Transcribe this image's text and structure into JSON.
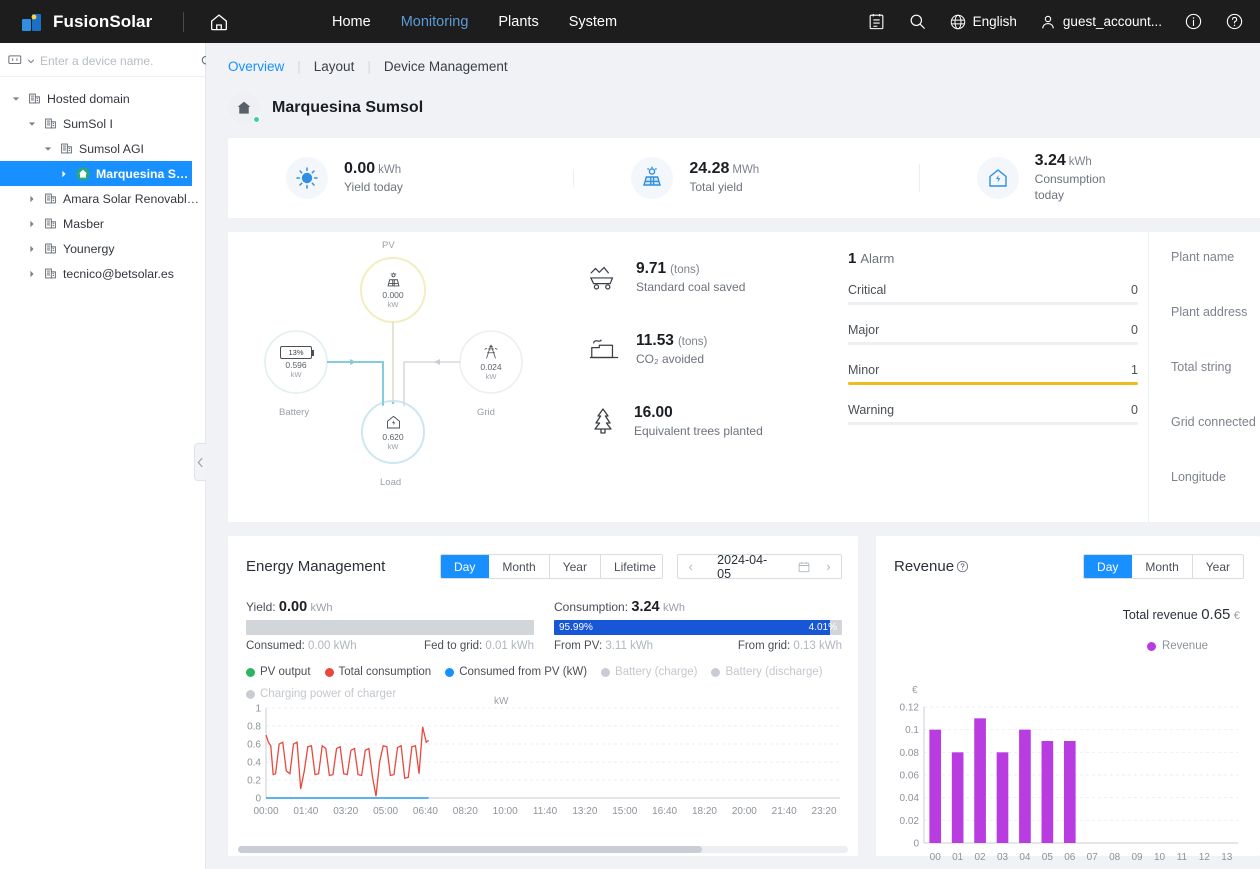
{
  "topnav": {
    "brand": "FusionSolar",
    "home_icon": "home-icon",
    "links": [
      {
        "label": "Home",
        "active": false
      },
      {
        "label": "Monitoring",
        "active": true
      },
      {
        "label": "Plants",
        "active": false
      },
      {
        "label": "System",
        "active": false
      }
    ],
    "right": {
      "report_icon": "report-icon",
      "search_icon": "search-icon",
      "language_icon": "globe-icon",
      "language": "English",
      "user_icon": "user-icon",
      "user": "guest_account...",
      "info_icon": "info-icon",
      "help_icon": "help-icon"
    }
  },
  "sidebar": {
    "device_selector_icon": "device-filter-icon",
    "search_placeholder": "Enter a device name.",
    "search_value": "",
    "search_icon": "search-icon",
    "collapse_icon": "chevron-left-icon",
    "tree": [
      {
        "label": "Hosted domain",
        "depth": 0,
        "expanded": true,
        "icon": "domain-icon",
        "selected": false
      },
      {
        "label": "SumSol I",
        "depth": 1,
        "expanded": true,
        "icon": "domain-icon",
        "selected": false
      },
      {
        "label": "Sumsol AGI",
        "depth": 2,
        "expanded": true,
        "icon": "domain-icon",
        "selected": false
      },
      {
        "label": "Marquesina Sumsol",
        "depth": 3,
        "expanded": false,
        "icon": "plant-icon",
        "selected": true
      },
      {
        "label": "Amara Solar Renovables ...",
        "depth": 1,
        "expanded": false,
        "icon": "domain-icon",
        "selected": false
      },
      {
        "label": "Masber",
        "depth": 1,
        "expanded": false,
        "icon": "domain-icon",
        "selected": false
      },
      {
        "label": "Younergy",
        "depth": 1,
        "expanded": false,
        "icon": "domain-icon",
        "selected": false
      },
      {
        "label": "tecnico@betsolar.es",
        "depth": 1,
        "expanded": false,
        "icon": "domain-icon",
        "selected": false
      }
    ]
  },
  "subnav": {
    "items": [
      {
        "label": "Overview",
        "active": true
      },
      {
        "label": "Layout",
        "active": false
      },
      {
        "label": "Device Management",
        "active": false
      }
    ],
    "separator": "|"
  },
  "plant": {
    "name": "Marquesina Sumsol",
    "status_icon": "plant-home-icon"
  },
  "kpis": [
    {
      "value": "0.00",
      "unit": "kWh",
      "label": "Yield today",
      "icon": "sun-yield-icon"
    },
    {
      "value": "24.28",
      "unit": "MWh",
      "label": "Total yield",
      "icon": "solar-panel-icon"
    },
    {
      "value": "3.24",
      "unit": "kWh",
      "label": "Consumption today",
      "icon": "consumption-icon"
    }
  ],
  "flow": {
    "nodes": [
      {
        "id": "pv",
        "caption": "PV",
        "value": "0.000",
        "unit": "kW",
        "icon": "solar-panel-icon"
      },
      {
        "id": "battery",
        "caption": "Battery",
        "value": "0.596",
        "unit": "kW",
        "icon": "battery-icon",
        "soc": "13%"
      },
      {
        "id": "grid",
        "caption": "Grid",
        "value": "0.024",
        "unit": "kW",
        "icon": "pylon-icon"
      },
      {
        "id": "load",
        "caption": "Load",
        "value": "0.620",
        "unit": "kW",
        "icon": "house-icon"
      }
    ]
  },
  "environment": [
    {
      "value": "9.71",
      "unit": "(tons)",
      "label": "Standard coal saved",
      "icon": "coal-cart-icon"
    },
    {
      "value": "11.53",
      "unit": "(tons)",
      "label": "CO₂ avoided",
      "icon": "factory-icon"
    },
    {
      "value": "16.00",
      "unit": "",
      "label": "Equivalent trees planted",
      "icon": "tree-icon"
    }
  ],
  "alarms": {
    "count": "1",
    "title": "Alarm",
    "rows": [
      {
        "label": "Critical",
        "value": "0",
        "filled": false
      },
      {
        "label": "Major",
        "value": "0",
        "filled": false
      },
      {
        "label": "Minor",
        "value": "1",
        "filled": true
      },
      {
        "label": "Warning",
        "value": "0",
        "filled": false
      }
    ],
    "bar_color": "#f0bb20"
  },
  "plant_info": [
    {
      "label": "Plant name"
    },
    {
      "label": "Plant address"
    },
    {
      "label": "Total string"
    },
    {
      "label": "Grid connected"
    },
    {
      "label": "Longitude"
    }
  ],
  "energy_panel": {
    "title": "Energy Management",
    "range_tabs": [
      {
        "label": "Day",
        "active": true
      },
      {
        "label": "Month",
        "active": false
      },
      {
        "label": "Year",
        "active": false
      },
      {
        "label": "Lifetime",
        "active": false
      }
    ],
    "date": "2024-04-05",
    "prev_icon": "chevron-left-icon",
    "next_icon": "chevron-right-icon",
    "calendar_icon": "calendar-icon",
    "yield": {
      "title_label": "Yield:",
      "value": "0.00",
      "unit": "kWh",
      "left_label": "Consumed:",
      "left_value": "0.00 kWh",
      "right_label": "Fed to grid:",
      "right_value": "0.01 kWh",
      "bar_left_pct": "",
      "bar_right_pct": "",
      "fill_percent": 0
    },
    "consumption": {
      "title_label": "Consumption:",
      "value": "3.24",
      "unit": "kWh",
      "left_label": "From PV:",
      "left_value": "3.11 kWh",
      "right_label": "From grid:",
      "right_value": "0.13 kWh",
      "bar_left_pct": "95.99%",
      "bar_right_pct": "4.01%",
      "fill_percent": 95.99
    },
    "legend": [
      {
        "label": "PV output",
        "color": "#2cb463",
        "active": true
      },
      {
        "label": "Total consumption",
        "color": "#e8483f",
        "active": true
      },
      {
        "label": "Consumed from PV (kW)",
        "color": "#1890ff",
        "active": true
      },
      {
        "label": "Battery (charge)",
        "color": "#c8cdd4",
        "active": false
      },
      {
        "label": "Battery (discharge)",
        "color": "#c8cdd4",
        "active": false
      },
      {
        "label": "Charging power of charger",
        "color": "#c8cdd4",
        "active": false
      }
    ]
  },
  "revenue_panel": {
    "title": "Revenue",
    "help_icon": "question-circle-icon",
    "range_tabs": [
      {
        "label": "Day",
        "active": true
      },
      {
        "label": "Month",
        "active": false
      },
      {
        "label": "Year",
        "active": false
      }
    ],
    "total_label": "Total revenue",
    "total_value": "0.65",
    "currency": "€",
    "legend_label": "Revenue",
    "legend_color": "#b83ce0"
  },
  "chart_data": [
    {
      "type": "line",
      "title": "Energy Management",
      "ylabel": "kW",
      "xlabel": "",
      "ylim": [
        0,
        1
      ],
      "yticks": [
        0,
        0.2,
        0.4,
        0.6,
        0.8,
        1
      ],
      "ytick_labels": [
        "0",
        "0.2",
        "0.4",
        "0.6",
        "0.8",
        "1"
      ],
      "xtick_labels": [
        "00:00",
        "01:40",
        "03:20",
        "05:00",
        "06:40",
        "08:20",
        "10:00",
        "11:40",
        "13:20",
        "15:00",
        "16:40",
        "18:20",
        "20:00",
        "21:40",
        "23:20"
      ],
      "grid": true,
      "legend_position": "top",
      "series": [
        {
          "name": "Total consumption",
          "color": "#e8483f",
          "x": [
            0.0,
            0.1,
            0.2,
            0.3,
            0.4,
            0.55,
            0.7,
            0.85,
            1.0,
            1.15,
            1.3,
            1.45,
            1.6,
            1.75,
            1.9,
            2.05,
            2.2,
            2.35,
            2.5,
            2.65,
            2.8,
            2.95,
            3.1,
            3.25,
            3.4,
            3.55,
            3.7,
            3.85,
            4.0,
            4.15,
            4.3,
            4.45,
            4.6,
            4.75,
            4.9,
            5.05,
            5.2,
            5.35,
            5.5,
            5.65,
            5.8,
            5.95,
            6.1,
            6.25,
            6.4,
            6.55,
            6.7,
            6.8
          ],
          "y": [
            0.7,
            0.62,
            0.58,
            0.26,
            0.27,
            0.6,
            0.62,
            0.3,
            0.27,
            0.6,
            0.62,
            0.1,
            0.3,
            0.57,
            0.58,
            0.26,
            0.27,
            0.58,
            0.55,
            0.25,
            0.26,
            0.55,
            0.57,
            0.27,
            0.26,
            0.53,
            0.55,
            0.26,
            0.25,
            0.53,
            0.55,
            0.24,
            0.02,
            0.4,
            0.58,
            0.57,
            0.25,
            0.26,
            0.56,
            0.58,
            0.22,
            0.23,
            0.57,
            0.58,
            0.27,
            0.79,
            0.62,
            0.64
          ]
        },
        {
          "name": "PV output",
          "color": "#2cb463",
          "x": [
            0,
            6.8
          ],
          "y": [
            0,
            0
          ]
        },
        {
          "name": "Consumed from PV (kW)",
          "color": "#1890ff",
          "x": [
            0,
            6.8
          ],
          "y": [
            0,
            0
          ]
        }
      ]
    },
    {
      "type": "bar",
      "title": "Revenue",
      "ylabel": "€",
      "xlabel": "",
      "ylim": [
        0,
        0.12
      ],
      "yticks": [
        0,
        0.02,
        0.04,
        0.06,
        0.08,
        0.1,
        0.12
      ],
      "ytick_labels": [
        "0",
        "0.02",
        "0.04",
        "0.06",
        "0.08",
        "0.1",
        "0.12"
      ],
      "categories": [
        "00",
        "01",
        "02",
        "03",
        "04",
        "05",
        "06",
        "07",
        "08",
        "09",
        "10",
        "11",
        "12",
        "13"
      ],
      "values": [
        0.1,
        0.08,
        0.11,
        0.08,
        0.1,
        0.09,
        0.09,
        null,
        null,
        null,
        null,
        null,
        null,
        null
      ],
      "series_name": "Revenue",
      "color": "#b83ce0",
      "grid": true
    }
  ]
}
